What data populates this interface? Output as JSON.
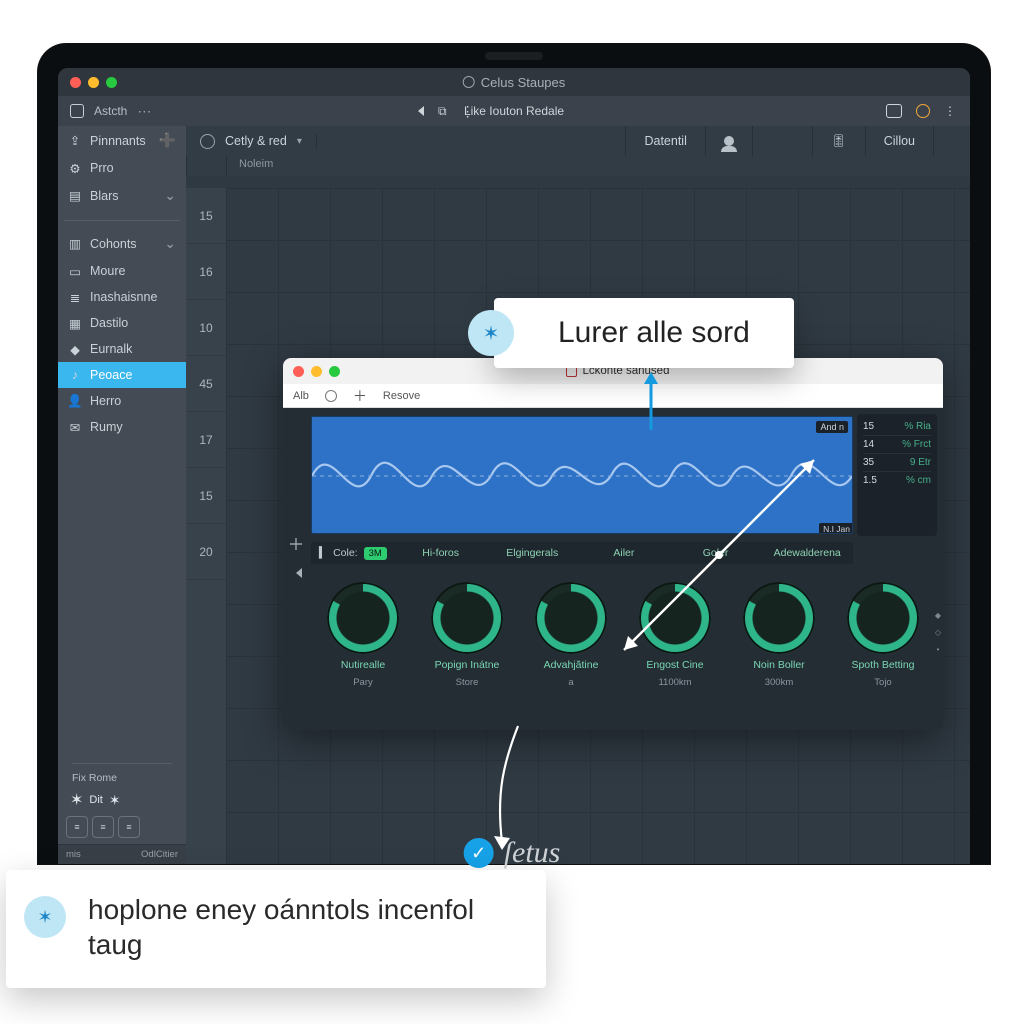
{
  "window": {
    "title": "Celus Staupes",
    "toolbar": {
      "left_label": "Astcth",
      "center_label": "Like Iouton Redale"
    }
  },
  "sidebar": {
    "groups": {
      "a": [
        {
          "icon": "anchor-icon",
          "label": "Pinnnants",
          "aux": "➕"
        },
        {
          "icon": "gear-icon",
          "label": "Prro"
        },
        {
          "icon": "calendar-icon",
          "label": "Blars",
          "aux": "⌄"
        }
      ],
      "b": [
        {
          "icon": "layers-icon",
          "label": "Cohonts",
          "aux": "⌄"
        },
        {
          "icon": "book-icon",
          "label": "Moure"
        },
        {
          "icon": "news-icon",
          "label": "Inashaisnne"
        },
        {
          "icon": "image-icon",
          "label": "Dastilo"
        },
        {
          "icon": "diamond-icon",
          "label": "Eurnalk"
        },
        {
          "icon": "music-icon",
          "label": "Peoace",
          "active": true
        },
        {
          "icon": "user-icon",
          "label": "Herro"
        },
        {
          "icon": "mail-icon",
          "label": "Rumy"
        }
      ]
    },
    "footer_label": "Fix Rome",
    "dit_label": "Dit",
    "status_left": "mis",
    "status_right": "OdlCitier"
  },
  "main": {
    "header": {
      "source_label": "Cetly & red",
      "cells": [
        "Datentil",
        "Cillou"
      ]
    },
    "column_label": "Noleim",
    "ruler": [
      "15",
      "16",
      "10",
      "45",
      "17",
      "15",
      "20"
    ]
  },
  "inner": {
    "title": "Lckonte sanused",
    "tabs": {
      "first": "Alb",
      "resolve": "Resove"
    },
    "wave_badge_top": "And n",
    "wave_badge_bottom": "N.I Jan",
    "meters": [
      {
        "v": "15",
        "u": "% Ria"
      },
      {
        "v": "14",
        "u": "% Frct"
      },
      {
        "v": "35",
        "u": "9 Etr"
      },
      {
        "v": "1.5",
        "u": "% cm"
      }
    ],
    "labels_row": {
      "first": "Cole:",
      "chip": "3M",
      "cells": [
        "Hi-foros",
        "Elgingerals",
        "Ailer",
        "Goler",
        "Adewalderena"
      ]
    },
    "knobs": [
      {
        "label": "Nutirealle",
        "sub": "Pary"
      },
      {
        "label": "Popign Inátne",
        "sub": "Store"
      },
      {
        "label": "Advahjătine",
        "sub": "a"
      },
      {
        "label": "Engost Cine",
        "sub": "1100km"
      },
      {
        "label": "Noin Boller",
        "sub": "300km"
      },
      {
        "label": "Spoth Betting",
        "sub": "Tojo"
      }
    ]
  },
  "callouts": {
    "one": "Lurer alle sord",
    "two": "hoplone eney oánntols incenfol taug"
  },
  "brand": "ſetus"
}
